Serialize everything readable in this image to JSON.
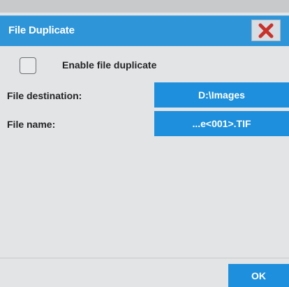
{
  "dialog": {
    "title": "File Duplicate",
    "close_icon": "close-x-icon",
    "accent_color": "#2f95d9",
    "close_icon_color": "#c8322b"
  },
  "enable": {
    "label": "Enable file duplicate",
    "checked": false
  },
  "fields": [
    {
      "label": "File destination:",
      "value": "D:\\Images"
    },
    {
      "label": "File name:",
      "value": "...e<001>.TIF"
    }
  ],
  "footer": {
    "ok_label": "OK"
  }
}
